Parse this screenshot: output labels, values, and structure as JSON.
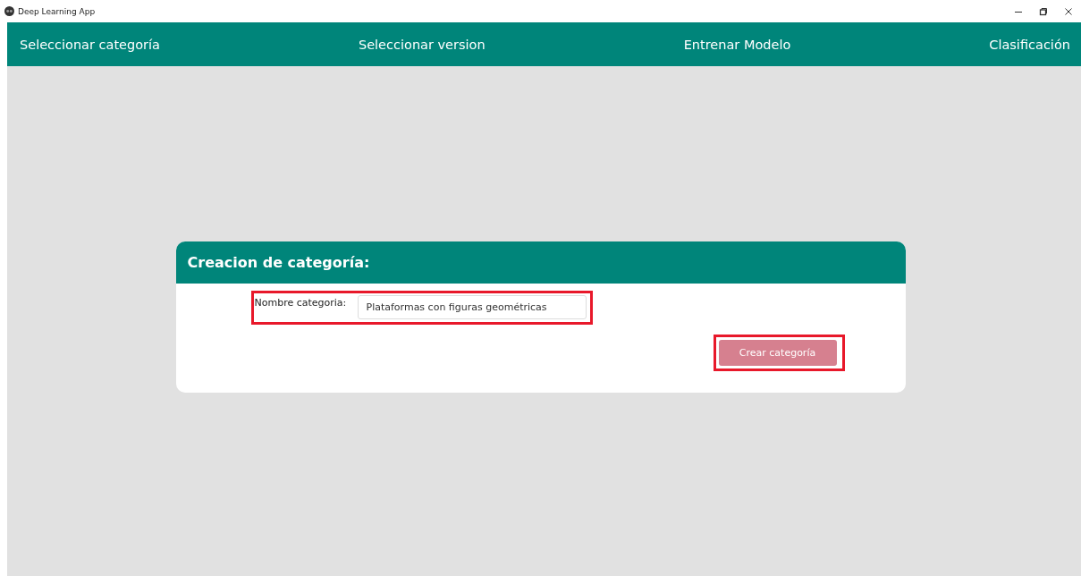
{
  "window": {
    "title": "Deep Learning App"
  },
  "nav": {
    "items": [
      {
        "label": "Seleccionar categoría"
      },
      {
        "label": "Seleccionar version"
      },
      {
        "label": "Entrenar Modelo"
      },
      {
        "label": "Clasificación"
      }
    ]
  },
  "card": {
    "title": "Creacion de categoría:",
    "field": {
      "label": "Nombre categoria:",
      "value": "Plataformas con figuras geométricas",
      "highlighted": true
    },
    "button": {
      "label": "Crear categoría",
      "disabled": true,
      "highlighted": true
    }
  }
}
